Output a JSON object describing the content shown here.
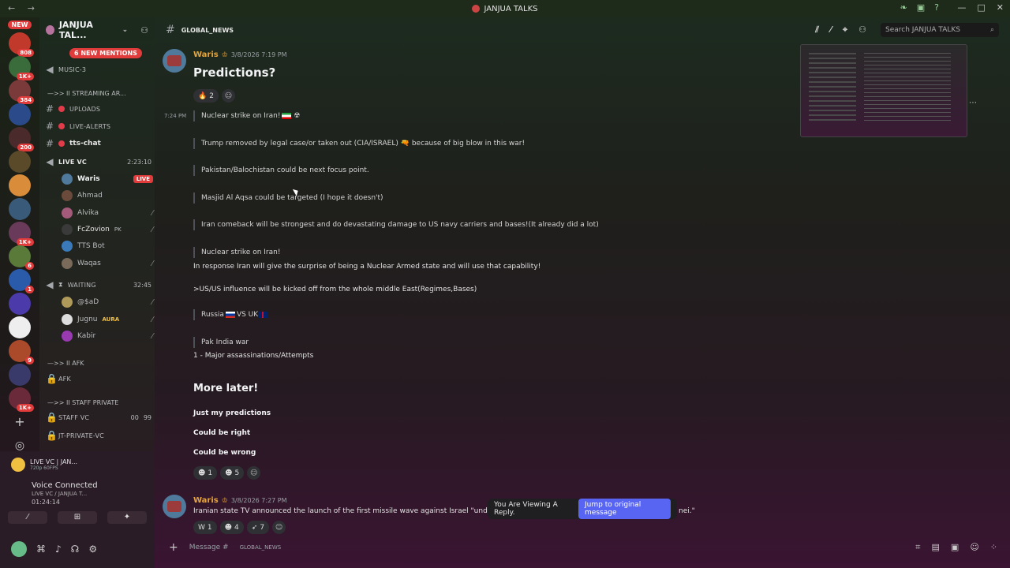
{
  "window": {
    "title": "JANJUA TALKS",
    "back": "←",
    "forward": "→"
  },
  "rail": {
    "new_label": "NEW",
    "badges": [
      "808",
      "1K+",
      "384",
      "",
      "200",
      "",
      "",
      "",
      "1K+",
      "6",
      "1",
      "",
      "",
      "9",
      "",
      "1K+"
    ]
  },
  "sidebar": {
    "server_name": "JANJUA TAL...",
    "new_mentions": "6 NEW MENTIONS",
    "music_channel": "MUSIC-3",
    "streaming_category": "STREAMING AR...",
    "category_prefix": "—>> ıı",
    "channels": [
      {
        "label": "UPLOADS"
      },
      {
        "label": "LIVE-ALERTS"
      },
      {
        "label": "tts-chat"
      }
    ],
    "live_vc": {
      "label": "LIVE VC",
      "time": "2:23:10"
    },
    "live_vc_users": [
      {
        "name": "Waris",
        "status": "LIVE"
      },
      {
        "name": "Ahmad"
      },
      {
        "name": "Alvika"
      },
      {
        "name": "FcZovion",
        "tag": "PK"
      },
      {
        "name": "TTS Bot"
      },
      {
        "name": "Waqas"
      }
    ],
    "waiting": {
      "label": "WAITING",
      "time": "32:45"
    },
    "waiting_users": [
      {
        "name": "@$aD"
      },
      {
        "name": "Jugnu",
        "tag": "AURA"
      },
      {
        "name": "Kabir"
      }
    ],
    "afk_category": "AFK",
    "afk_channel": "AFK",
    "staff_category": "STAFF PRIVATE",
    "staff_vc": {
      "label": "STAFF VC",
      "count": "00",
      "limit": "99"
    },
    "jt_private": "JT-PRIVATE-VC"
  },
  "voice_panel": {
    "channel": "LIVE VC | JAN...",
    "quality": "720p 60FPS",
    "status": "Voice Connected",
    "sub": "LIVE VC / JANJUA T...",
    "time": "01:24:14"
  },
  "header": {
    "channel": "GLOBAL_NEWS",
    "search_placeholder": "Search JANJUA TALKS"
  },
  "messages": [
    {
      "author": "Waris",
      "timestamp": "3/8/2026 7:19 PM",
      "heading": "Predictions?",
      "reaction_count": "2",
      "side_time": "7:24 PM",
      "quotes": [
        "Nuclear strike on Iran!",
        "Trump removed by legal case/or taken out (CIA/ISRAEL) 🔫 because of big blow in this war!",
        "Pakistan/Balochistan could be next focus point.",
        "Masjid Al Aqsa could be targeted (I hope it doesn't)",
        "Iran comeback will be strongest and do devastating damage to US navy carriers and bases!(It already did a lot)",
        "Nuclear strike on Iran!"
      ],
      "line1": "In response Iran will give the surprise of being a Nuclear Armed state and will use that capability!",
      "line2": ">US/US influence will be kicked off from the whole  middle East(Regimes,Bases)",
      "quote_russia": "Russia",
      "quote_vs": "VS  UK",
      "quote_pak": "Pak India war",
      "line3": "1 - Major assassinations/Attempts",
      "more_later": "More later!",
      "just": "Just my predictions",
      "right": "Could be right",
      "wrong": "Could be wrong",
      "reactions2": [
        "1",
        "5"
      ]
    },
    {
      "author": "Waris",
      "timestamp": "3/8/2026 7:27 PM",
      "text": "Iranian state TV announced the launch of the first missile wave against Israel \"unde",
      "text_tail": "nei.\"",
      "reactions": [
        "1",
        "4",
        "7"
      ]
    }
  ],
  "reply_bar": {
    "text": "You Are Viewing A Reply.",
    "button": "Jump to original message"
  },
  "composer": {
    "placeholder": "Message #",
    "channel": "GLOBAL_NEWS"
  }
}
